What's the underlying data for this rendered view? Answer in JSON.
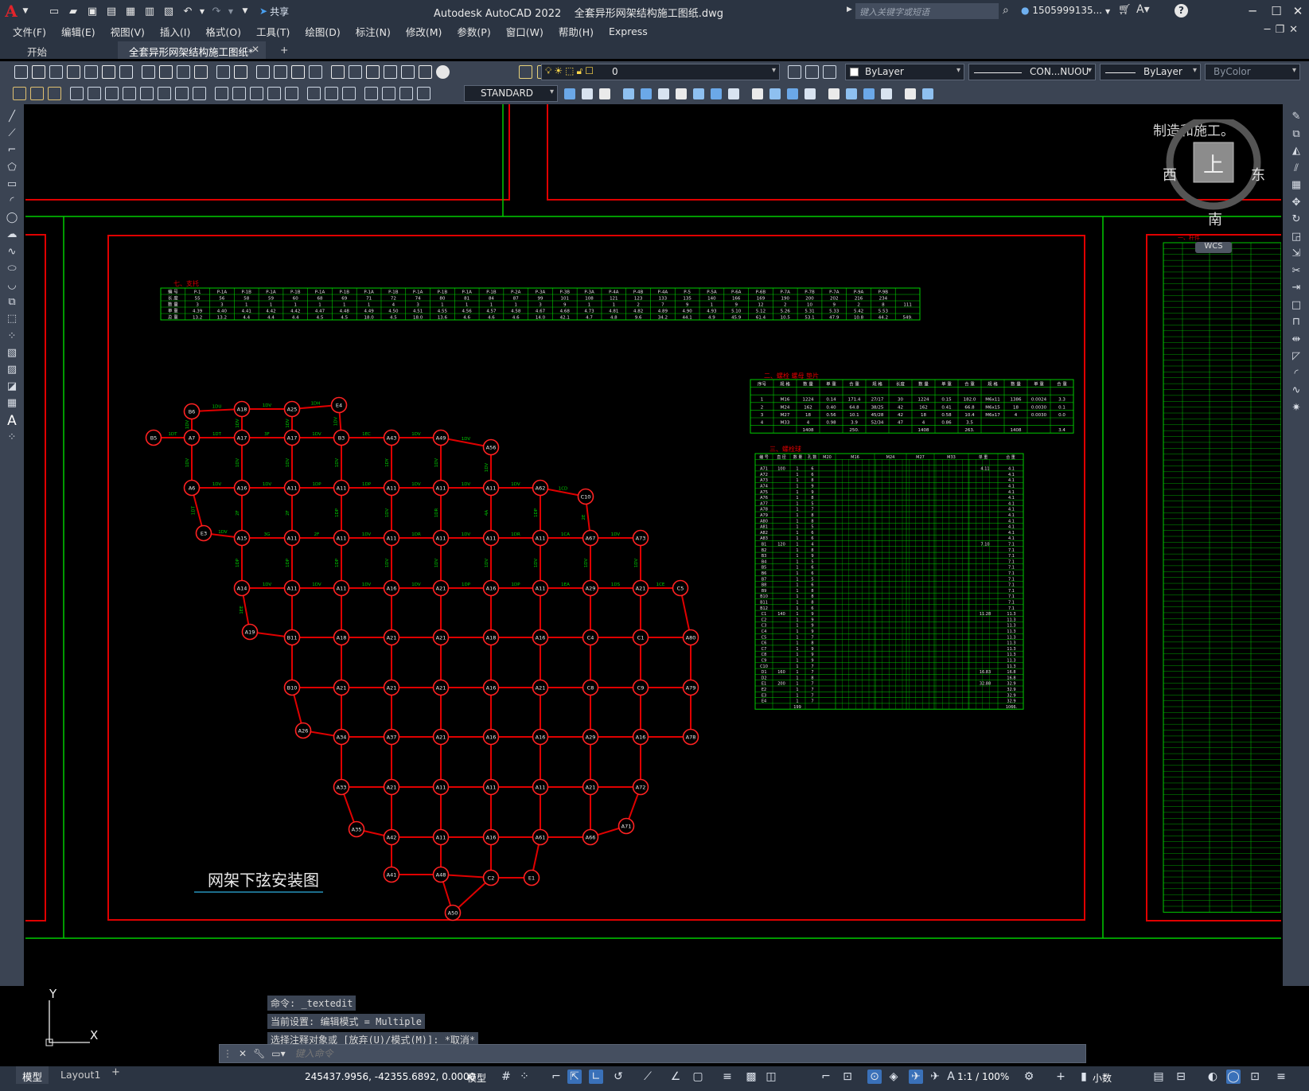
{
  "app": {
    "logo": "A",
    "title": "Autodesk AutoCAD 2022",
    "file": "全套异形网架结构施工图纸.dwg",
    "share": "共享",
    "search_placeholder": "键入关键字或短语",
    "user": "1505999135..."
  },
  "menus": [
    "文件(F)",
    "编辑(E)",
    "视图(V)",
    "插入(I)",
    "格式(O)",
    "工具(T)",
    "绘图(D)",
    "标注(N)",
    "修改(M)",
    "参数(P)",
    "窗口(W)",
    "帮助(H)",
    "Express"
  ],
  "tabs": {
    "start": "开始",
    "drawing": "全套异形网架结构施工图纸*",
    "add": "+"
  },
  "toolbar": {
    "layer": "0",
    "color": "ByLayer",
    "linetype": "CON...NUOU",
    "lineweight": "ByLayer",
    "plotstyle": "ByColor",
    "textstyle": "STANDARD"
  },
  "viewcube": {
    "north_hint": "制造和施工。",
    "top": "上",
    "west": "西",
    "east": "东",
    "south": "南",
    "wcs": "WCS"
  },
  "drawing": {
    "title": "网架下弦安装图",
    "section_material": "七、支托",
    "section_bolt": "二、螺栓 螺母 垫片",
    "section_ball": "三、螺栓球",
    "section_rod": "一、杆件",
    "nodes": [
      "B5",
      "B6",
      "A7",
      "A18",
      "A25",
      "E4",
      "A17",
      "A17",
      "B3",
      "A43",
      "A49",
      "A56",
      "A6",
      "A16",
      "A11",
      "A11",
      "A11",
      "A11",
      "A11",
      "A62",
      "C10",
      "E3",
      "A15",
      "A11",
      "A11",
      "A11",
      "A11",
      "A11",
      "A11",
      "A67",
      "A73",
      "A14",
      "A11",
      "A11",
      "A16",
      "A21",
      "A16",
      "A11",
      "A29",
      "A21",
      "C5",
      "A19",
      "B11",
      "A18",
      "A21",
      "A21",
      "A18",
      "A16",
      "C4",
      "C1",
      "A80",
      "B10",
      "A21",
      "A21",
      "A21",
      "A16",
      "A21",
      "C8",
      "C9",
      "A79",
      "A26",
      "A34",
      "A37",
      "A21",
      "A16",
      "A16",
      "A29",
      "A16",
      "A78",
      "A33",
      "A21",
      "A11",
      "A11",
      "A11",
      "A21",
      "A72",
      "A35",
      "A42",
      "A11",
      "A16",
      "A61",
      "A66",
      "A71",
      "A41",
      "A48",
      "C2",
      "E1",
      "A50"
    ],
    "bars": [
      "1DT",
      "1DU",
      "1DV",
      "1DH",
      "1DV",
      "1DT",
      "3F",
      "1DV",
      "1EC",
      "1DV",
      "1DV",
      "1DV",
      "1DV",
      "1DV",
      "1DV",
      "1DV",
      "1DV",
      "1DV",
      "1DY",
      "1DV",
      "1DV",
      "1DV",
      "1DV",
      "1DP",
      "1DP",
      "1DV",
      "1DV",
      "1DV",
      "1CD",
      "1DT",
      "2F",
      "2F",
      "1DP",
      "1DV",
      "1DR",
      "4A",
      "1DP",
      "2E",
      "1DV",
      "3G",
      "2F",
      "1DV",
      "1DR",
      "1DV",
      "1DR",
      "1CA",
      "1DV",
      "1DP",
      "1DP",
      "1DP",
      "1DV",
      "1DV",
      "1DV",
      "1DV",
      "1DV",
      "1DV",
      "1DV",
      "1DV",
      "1DV",
      "1DV",
      "1DP",
      "1DP",
      "1EA",
      "1DS",
      "1CE",
      "1EE"
    ],
    "material_table": {
      "headers": [
        "编 号",
        "P-1",
        "P-1A",
        "P-1B",
        "P-1A",
        "P-1B",
        "P-1A",
        "P-1B",
        "P-1A",
        "P-1B",
        "P-1A",
        "P-1B",
        "P-1A",
        "P-1B",
        "P-2A",
        "P-3A",
        "P-3B",
        "P-3A",
        "P-4A",
        "P-4B",
        "P-4A",
        "P-5",
        "P-5A",
        "P-6A",
        "P-6B",
        "P-7A",
        "P-7B",
        "P-7A",
        "P-9A",
        "P-9B"
      ],
      "rows": [
        [
          "长 度",
          "55",
          "56",
          "58",
          "59",
          "60",
          "68",
          "69",
          "71",
          "72",
          "74",
          "80",
          "81",
          "84",
          "87",
          "99",
          "101",
          "108",
          "121",
          "123",
          "133",
          "135",
          "140",
          "166",
          "169",
          "190",
          "200",
          "202",
          "216",
          "234"
        ],
        [
          "数 量",
          "3",
          "3",
          "1",
          "1",
          "1",
          "1",
          "1",
          "1",
          "4",
          "3",
          "1",
          "1",
          "1",
          "1",
          "3",
          "9",
          "1",
          "1",
          "2",
          "7",
          "9",
          "1",
          "9",
          "12",
          "2",
          "10",
          "9",
          "2",
          "8",
          "111"
        ],
        [
          "单 重",
          "4.39",
          "4.40",
          "4.41",
          "4.42",
          "4.42",
          "4.47",
          "4.48",
          "4.49",
          "4.50",
          "4.51",
          "4.55",
          "4.56",
          "4.57",
          "4.58",
          "4.67",
          "4.68",
          "4.73",
          "4.81",
          "4.82",
          "4.89",
          "4.90",
          "4.93",
          "5.10",
          "5.12",
          "5.26",
          "5.31",
          "5.33",
          "5.42",
          "5.53"
        ],
        [
          "总 重",
          "13.2",
          "13.2",
          "4.4",
          "4.4",
          "4.4",
          "4.5",
          "4.5",
          "18.0",
          "4.5",
          "18.0",
          "13.6",
          "4.6",
          "4.6",
          "4.6",
          "14.0",
          "42.1",
          "4.7",
          "4.8",
          "9.6",
          "34.2",
          "44.1",
          "4.9",
          "45.9",
          "61.4",
          "10.5",
          "53.1",
          "47.9",
          "10.8",
          "44.2",
          "549."
        ]
      ]
    },
    "bolt_table": {
      "headers": [
        "序号",
        "规 格",
        "数 量",
        "单 重",
        "合 重",
        "规 格",
        "长度",
        "数 量",
        "单 重",
        "合 重",
        "规 格",
        "数 量",
        "单 重",
        "合 重"
      ],
      "rows": [
        [
          "1",
          "M16",
          "1224",
          "0.14",
          "171.4",
          "27/17",
          "30",
          "1224",
          "0.15",
          "182.0",
          "M6x11",
          "1386",
          "0.0024",
          "3.3"
        ],
        [
          "2",
          "M24",
          "162",
          "0.40",
          "64.8",
          "38/25",
          "42",
          "162",
          "0.41",
          "66.8",
          "M6x15",
          "18",
          "0.0030",
          "0.1"
        ],
        [
          "3",
          "M27",
          "18",
          "0.56",
          "10.1",
          "45/28",
          "42",
          "18",
          "0.58",
          "10.4",
          "M6x17",
          "4",
          "0.0030",
          "0.0"
        ],
        [
          "4",
          "M33",
          "4",
          "0.98",
          "3.9",
          "52/34",
          "47",
          "4",
          "0.86",
          "3.5",
          "",
          "",
          "",
          ""
        ],
        [
          "",
          "",
          "1408",
          "",
          "250.",
          "",
          "",
          "1408",
          "",
          "263.",
          "",
          "1408",
          "",
          "3.4"
        ]
      ]
    },
    "ball_table": {
      "headers": [
        "编 号",
        "直 径",
        "数 量",
        "孔 数",
        "M20",
        "M16",
        "M24",
        "M27",
        "M33",
        "单 重",
        "合 重"
      ],
      "rows": [
        [
          "A71",
          "100",
          "1",
          "6",
          "4.11",
          "4.1"
        ],
        [
          "A72",
          "",
          "1",
          "6",
          "",
          "4.1"
        ],
        [
          "A73",
          "",
          "1",
          "8",
          "",
          "4.1"
        ],
        [
          "A74",
          "",
          "1",
          "9",
          "",
          "4.1"
        ],
        [
          "A75",
          "",
          "1",
          "9",
          "",
          "4.1"
        ],
        [
          "A76",
          "",
          "1",
          "8",
          "",
          "4.1"
        ],
        [
          "A77",
          "",
          "1",
          "5",
          "",
          "4.1"
        ],
        [
          "A78",
          "",
          "1",
          "7",
          "",
          "4.1"
        ],
        [
          "A79",
          "",
          "1",
          "8",
          "",
          "4.1"
        ],
        [
          "A80",
          "",
          "1",
          "8",
          "",
          "4.1"
        ],
        [
          "A81",
          "",
          "1",
          "5",
          "",
          "4.1"
        ],
        [
          "A82",
          "",
          "1",
          "6",
          "",
          "4.1"
        ],
        [
          "A83",
          "",
          "1",
          "6",
          "",
          "4.1"
        ],
        [
          "B1",
          "120",
          "1",
          "4",
          "7.10",
          "7.1"
        ],
        [
          "B2",
          "",
          "1",
          "8",
          "",
          "7.1"
        ],
        [
          "B3",
          "",
          "1",
          "9",
          "",
          "7.1"
        ],
        [
          "B4",
          "",
          "1",
          "5",
          "",
          "7.1"
        ],
        [
          "B5",
          "",
          "1",
          "6",
          "",
          "7.1"
        ],
        [
          "B6",
          "",
          "1",
          "6",
          "",
          "7.1"
        ],
        [
          "B7",
          "",
          "1",
          "5",
          "",
          "7.1"
        ],
        [
          "B8",
          "",
          "1",
          "6",
          "",
          "7.1"
        ],
        [
          "B9",
          "",
          "1",
          "8",
          "",
          "7.1"
        ],
        [
          "B10",
          "",
          "1",
          "8",
          "",
          "7.1"
        ],
        [
          "B11",
          "",
          "1",
          "8",
          "",
          "7.1"
        ],
        [
          "B12",
          "",
          "1",
          "6",
          "",
          "7.1"
        ],
        [
          "C1",
          "140",
          "1",
          "9",
          "11.28",
          "11.3"
        ],
        [
          "C2",
          "",
          "1",
          "9",
          "",
          "11.3"
        ],
        [
          "C3",
          "",
          "1",
          "9",
          "",
          "11.3"
        ],
        [
          "C4",
          "",
          "1",
          "9",
          "",
          "11.3"
        ],
        [
          "C5",
          "",
          "1",
          "7",
          "",
          "11.3"
        ],
        [
          "C6",
          "",
          "1",
          "8",
          "",
          "11.3"
        ],
        [
          "C7",
          "",
          "1",
          "9",
          "",
          "11.3"
        ],
        [
          "C8",
          "",
          "1",
          "9",
          "",
          "11.3"
        ],
        [
          "C9",
          "",
          "1",
          "9",
          "",
          "11.3"
        ],
        [
          "C10",
          "",
          "1",
          "7",
          "",
          "11.3"
        ],
        [
          "D1",
          "160",
          "1",
          "7",
          "16.83",
          "16.8"
        ],
        [
          "D2",
          "",
          "1",
          "8",
          "",
          "16.8"
        ],
        [
          "E1",
          "200",
          "1",
          "7",
          "32.88",
          "32.9"
        ],
        [
          "E2",
          "",
          "1",
          "7",
          "",
          "32.9"
        ],
        [
          "E3",
          "",
          "1",
          "7",
          "",
          "32.9"
        ],
        [
          "E4",
          "",
          "1",
          "7",
          "",
          "32.9"
        ],
        [
          "",
          "",
          "199",
          "",
          "",
          "1066."
        ]
      ]
    }
  },
  "command": {
    "history": [
      "命令: _textedit",
      "当前设置: 编辑模式 = Multiple",
      "选择注释对象或 [放弃(U)/模式(M)]: *取消*"
    ],
    "placeholder": "键入命令"
  },
  "status": {
    "model_tab": "模型",
    "layout_tab": "Layout1",
    "add_layout": "+",
    "coords": "245437.9956, -42355.6892, 0.0000",
    "space": "模型",
    "scale": "1:1 / 100%",
    "units": "小数"
  },
  "ucs": {
    "x": "X",
    "y": "Y"
  },
  "colors": {
    "accent": "#3a71b9",
    "frame": "#e00000",
    "green": "#00cc00",
    "node": "#ff2222"
  }
}
